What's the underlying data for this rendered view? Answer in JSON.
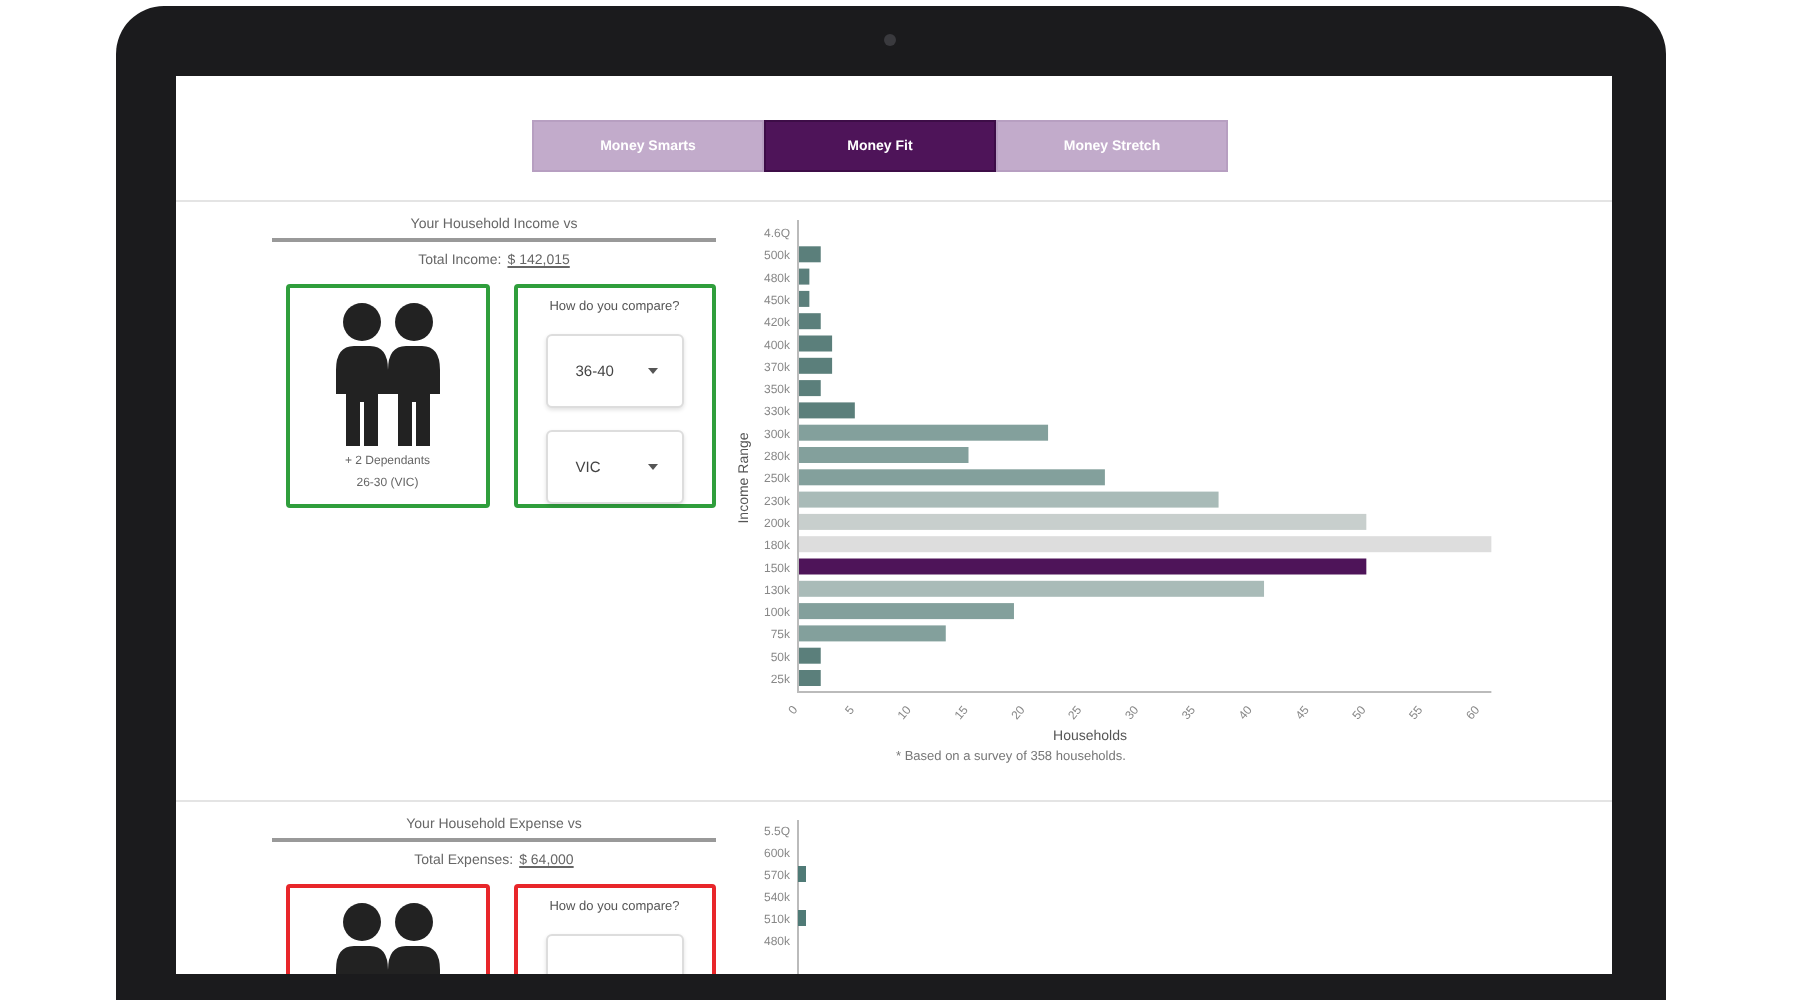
{
  "tabs": [
    {
      "label": "Money Smarts",
      "selected": false
    },
    {
      "label": "Money Fit",
      "selected": true
    },
    {
      "label": "Money Stretch",
      "selected": false
    }
  ],
  "sections": [
    {
      "title": "Your Household Income vs",
      "total_label": "Total Income:",
      "total_value": "$ 142,015",
      "color": "#2f9e3c",
      "profile": {
        "dependants": "+ 2 Dependants",
        "group": "26-30 (VIC)"
      },
      "compare": {
        "question": "How do you compare?",
        "dropdowns": [
          {
            "kind": "select",
            "value": "36-40"
          },
          {
            "kind": "select",
            "value": "VIC"
          }
        ]
      },
      "chart_data": {
        "type": "bar",
        "orientation": "horizontal",
        "xlabel": "Households",
        "ylabel": "Income Range",
        "categories": [
          "4.6Q",
          "500k",
          "480k",
          "450k",
          "420k",
          "400k",
          "370k",
          "350k",
          "330k",
          "300k",
          "280k",
          "250k",
          "230k",
          "200k",
          "180k",
          "150k",
          "130k",
          "100k",
          "75k",
          "50k",
          "25k"
        ],
        "series": [
          {
            "color": "#5b7f7b",
            "values": [
              null,
              2,
              1,
              1,
              2,
              3,
              3,
              2,
              5,
              null,
              null,
              null,
              null,
              null,
              null,
              null,
              null,
              null,
              null,
              2,
              2
            ]
          },
          {
            "color": "#83a09c",
            "values": [
              null,
              null,
              null,
              null,
              null,
              null,
              null,
              null,
              null,
              22,
              15,
              27,
              null,
              null,
              null,
              null,
              null,
              19,
              13,
              null,
              null
            ]
          },
          {
            "color": "#a9bbb8",
            "values": [
              null,
              null,
              null,
              null,
              null,
              null,
              null,
              null,
              null,
              null,
              null,
              null,
              37,
              null,
              null,
              null,
              41,
              null,
              null,
              null,
              null
            ]
          },
          {
            "color": "#c8cfcd",
            "values": [
              null,
              null,
              null,
              null,
              null,
              null,
              null,
              null,
              null,
              null,
              null,
              null,
              null,
              50,
              null,
              null,
              null,
              null,
              null,
              null,
              null
            ]
          },
          {
            "color": "#dddddd",
            "values": [
              null,
              null,
              null,
              null,
              null,
              null,
              null,
              null,
              null,
              null,
              null,
              null,
              null,
              null,
              61,
              null,
              null,
              null,
              null,
              null,
              null
            ]
          },
          {
            "color": "#4e1459",
            "values": [
              null,
              null,
              null,
              null,
              null,
              null,
              null,
              null,
              null,
              null,
              null,
              null,
              null,
              null,
              null,
              50,
              null,
              null,
              null,
              null,
              null
            ]
          }
        ],
        "xlim": [
          0,
          61
        ],
        "xticks": [
          0,
          5,
          10,
          15,
          20,
          25,
          30,
          35,
          40,
          45,
          50,
          55,
          60
        ]
      },
      "footnote": "* Based on a survey of 358 households."
    },
    {
      "title": "Your Household Expense vs",
      "total_label": "Total Expenses:",
      "total_value": "$ 64,000",
      "color": "#e8262a",
      "compare": {
        "question": "How do you compare?",
        "dropdowns": [
          {
            "kind": "select"
          }
        ]
      },
      "chart": {
        "labels": [
          {
            "label": "5.5Q",
            "bar": false
          },
          {
            "label": "600k",
            "bar": false
          },
          {
            "label": "570k",
            "bar": true
          },
          {
            "label": "540k",
            "bar": false
          },
          {
            "label": "510k",
            "bar": true
          },
          {
            "label": "480k",
            "bar": false
          }
        ]
      }
    }
  ]
}
